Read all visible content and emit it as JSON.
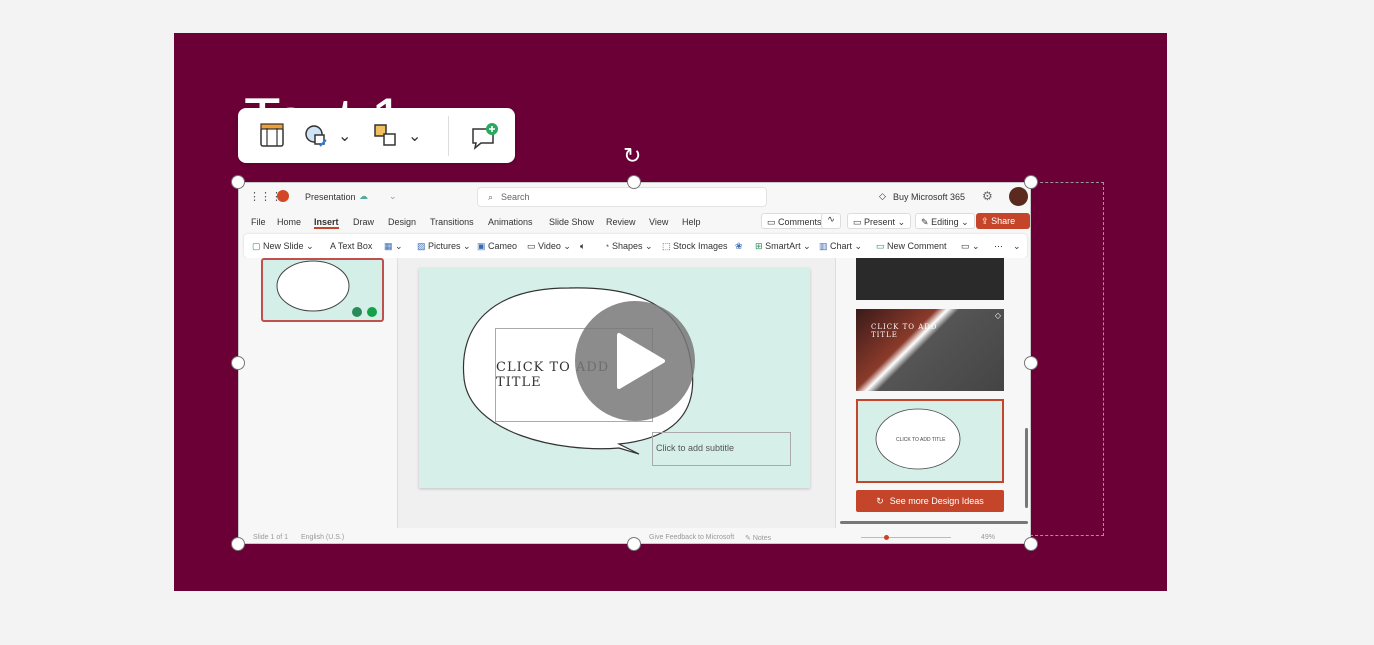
{
  "slide": {
    "title_partial": "Text 1",
    "background": "#6a0036"
  },
  "floatbar": {
    "buttons": [
      {
        "name": "storyboard-icon"
      },
      {
        "name": "shape-fill-icon"
      },
      {
        "name": "arrange-icon"
      },
      {
        "name": "new-comment-icon"
      }
    ]
  },
  "app": {
    "doc_title": "Presentation",
    "search_placeholder": "Search",
    "buy_label": "Buy Microsoft 365",
    "menu": [
      "File",
      "Home",
      "Insert",
      "Draw",
      "Design",
      "Transitions",
      "Animations",
      "Slide Show",
      "Review",
      "View",
      "Help"
    ],
    "active_menu": "Insert",
    "right_buttons": {
      "comments": "Comments",
      "present": "Present",
      "editing": "Editing",
      "share": "Share"
    },
    "ribbon": {
      "new_slide": "New Slide",
      "text_box": "Text Box",
      "pictures": "Pictures",
      "cameo": "Cameo",
      "video": "Video",
      "shapes": "Shapes",
      "stock_images": "Stock Images",
      "smartart": "SmartArt",
      "chart": "Chart",
      "new_comment": "New Comment"
    },
    "slide_title_placeholder": "CLICK TO ADD TITLE",
    "slide_subtitle_placeholder": "Click to add subtitle",
    "design_panel": {
      "design2_title": "CLICK TO ADD\nTITLE",
      "design3_title": "CLICK TO ADD TITLE",
      "see_more": "See more Design Ideas"
    },
    "status": {
      "slide_count": "Slide 1 of 1",
      "language": "English (U.S.)",
      "feedback": "Give Feedback to Microsoft",
      "notes": "Notes",
      "zoom": "49%"
    }
  }
}
